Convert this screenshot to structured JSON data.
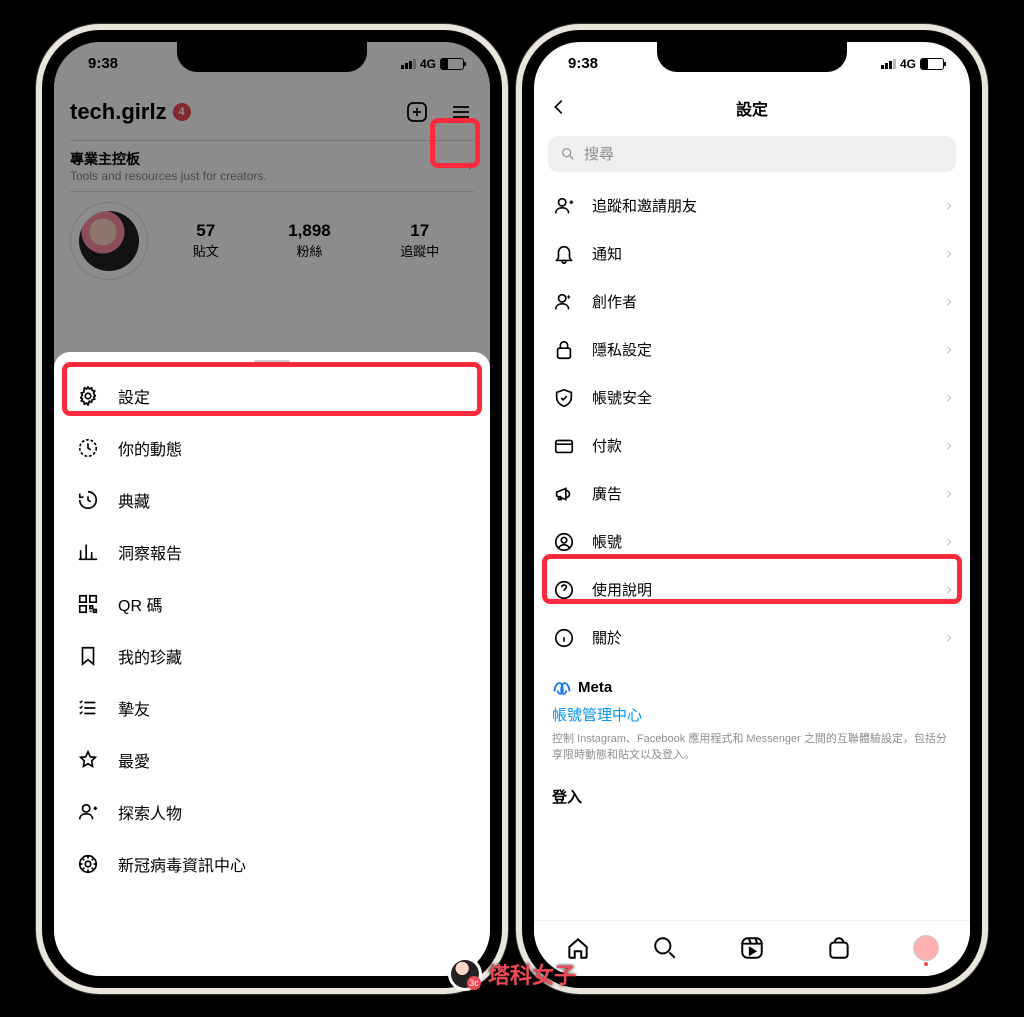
{
  "status": {
    "time": "9:38",
    "network": "4G"
  },
  "left": {
    "username": "tech.girlz",
    "badge": "4",
    "dashboard": {
      "title": "專業主控板",
      "subtitle": "Tools and resources just for creators."
    },
    "stats": [
      {
        "num": "57",
        "label": "貼文"
      },
      {
        "num": "1,898",
        "label": "粉絲"
      },
      {
        "num": "17",
        "label": "追蹤中"
      }
    ],
    "menu": [
      {
        "icon": "settings-icon",
        "label": "設定"
      },
      {
        "icon": "activity-icon",
        "label": "你的動態"
      },
      {
        "icon": "archive-icon",
        "label": "典藏"
      },
      {
        "icon": "insights-icon",
        "label": "洞察報告"
      },
      {
        "icon": "qrcode-icon",
        "label": "QR 碼"
      },
      {
        "icon": "saved-icon",
        "label": "我的珍藏"
      },
      {
        "icon": "closefriends-icon",
        "label": "摯友"
      },
      {
        "icon": "favorites-icon",
        "label": "最愛"
      },
      {
        "icon": "discover-icon",
        "label": "探索人物"
      },
      {
        "icon": "covid-icon",
        "label": "新冠病毒資訊中心"
      }
    ]
  },
  "right": {
    "title": "設定",
    "search_placeholder": "搜尋",
    "items": [
      {
        "icon": "follow-invite-icon",
        "label": "追蹤和邀請朋友"
      },
      {
        "icon": "bell-icon",
        "label": "通知"
      },
      {
        "icon": "creator-icon",
        "label": "創作者"
      },
      {
        "icon": "lock-icon",
        "label": "隱私設定"
      },
      {
        "icon": "shield-icon",
        "label": "帳號安全"
      },
      {
        "icon": "card-icon",
        "label": "付款"
      },
      {
        "icon": "megaphone-icon",
        "label": "廣告"
      },
      {
        "icon": "account-icon",
        "label": "帳號"
      },
      {
        "icon": "help-icon",
        "label": "使用說明"
      },
      {
        "icon": "info-icon",
        "label": "關於"
      }
    ],
    "meta": {
      "brand": "Meta",
      "link": "帳號管理中心",
      "desc": "控制 Instagram、Facebook 應用程式和 Messenger 之間的互聯體驗設定，包括分享限時動態和貼文以及登入。",
      "login_label": "登入"
    }
  },
  "watermark": "塔科女子"
}
